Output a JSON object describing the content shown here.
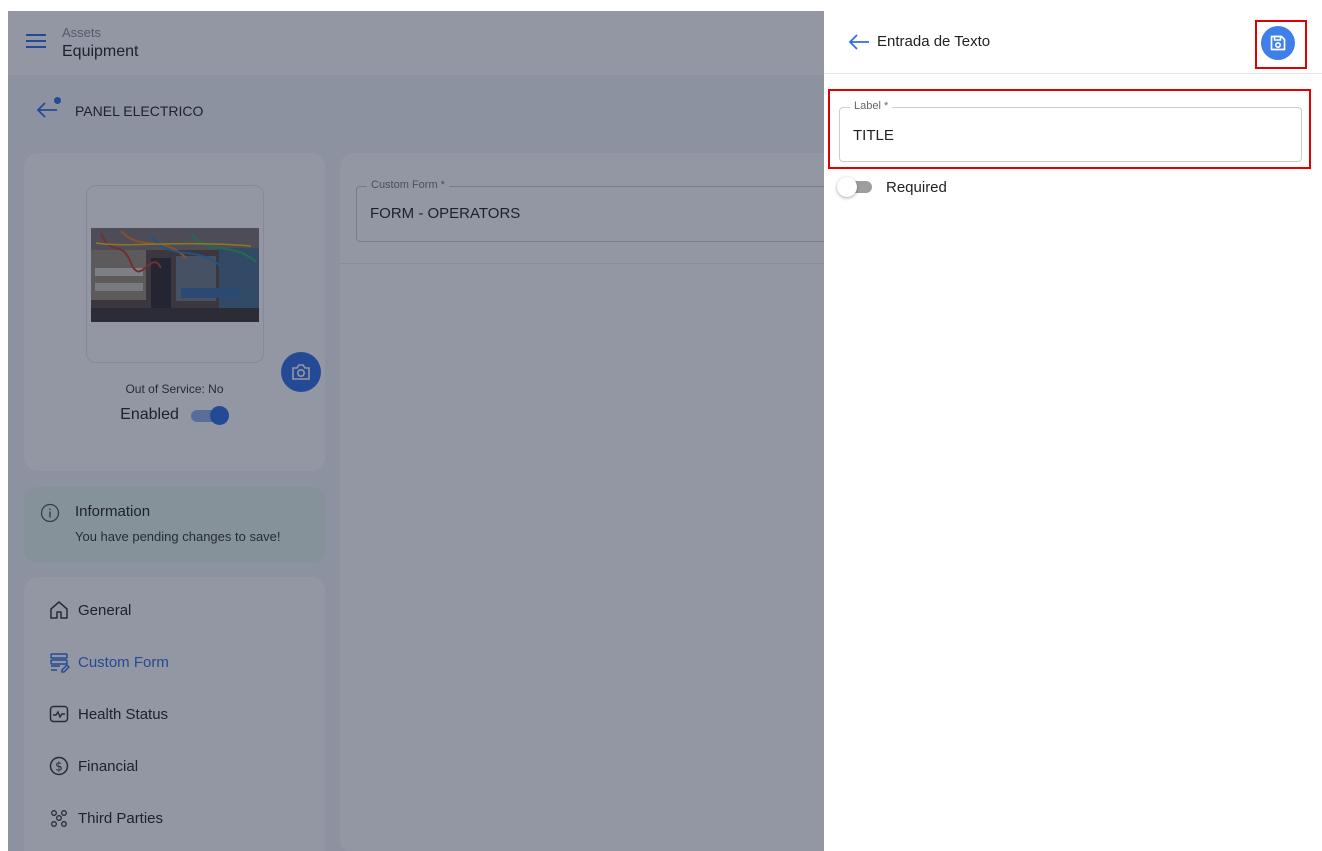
{
  "app": {
    "breadcrumb": "Assets",
    "section_title": "Equipment",
    "page_title": "PANEL ELECTRICO"
  },
  "equipment_card": {
    "out_of_service_text": "Out of Service: No",
    "enabled_label": "Enabled",
    "enabled": true
  },
  "info_banner": {
    "title": "Information",
    "message": "You have pending changes to save!"
  },
  "nav": {
    "items": [
      {
        "label": "General",
        "icon": "home-icon"
      },
      {
        "label": "Custom Form",
        "icon": "form-icon",
        "active": true
      },
      {
        "label": "Health Status",
        "icon": "health-icon"
      },
      {
        "label": "Financial",
        "icon": "dollar-icon"
      },
      {
        "label": "Third Parties",
        "icon": "people-icon"
      }
    ]
  },
  "custom_form": {
    "label": "Custom Form *",
    "value": "FORM - OPERATORS"
  },
  "panel": {
    "title": "Entrada de Texto",
    "label_field": {
      "label": "Label *",
      "value": "TITLE"
    },
    "required": {
      "label": "Required",
      "checked": false
    }
  },
  "colors": {
    "primary": "#2f6fe4",
    "highlight": "#e00000",
    "overlay": "rgba(25,35,60,0.47)",
    "info_bg": "#e6f6ec"
  }
}
